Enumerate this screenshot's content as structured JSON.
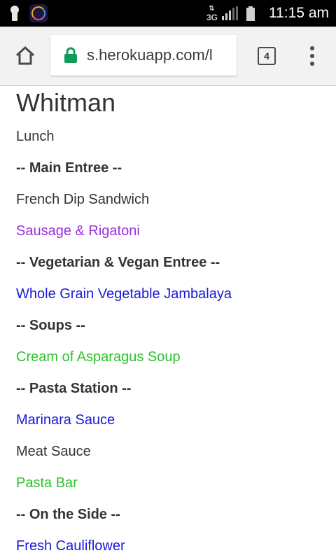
{
  "status_bar": {
    "network": "3G",
    "network_arrows": "⇅",
    "time": "11:15 am",
    "icons": [
      "keyhole-icon",
      "app-notification-icon",
      "signal-icon",
      "battery-icon"
    ]
  },
  "browser": {
    "url": "s.herokuapp.com/l",
    "tab_count": "4",
    "icons": [
      "home-icon",
      "lock-icon",
      "tab-switcher-icon",
      "overflow-menu-icon"
    ],
    "colors": {
      "lock": "#0f9d58",
      "toolbar": "#f2f2f2"
    }
  },
  "page": {
    "title": "Whitman",
    "items": [
      {
        "text": "Lunch",
        "kind": "meal",
        "color": "#333333"
      },
      {
        "text": "-- Main Entree --",
        "kind": "header",
        "color": "#333333"
      },
      {
        "text": "French Dip Sandwich",
        "kind": "item",
        "color": "#333333"
      },
      {
        "text": "Sausage & Rigatoni",
        "kind": "item",
        "color": "#9b30d9"
      },
      {
        "text": "-- Vegetarian & Vegan Entree --",
        "kind": "header",
        "color": "#333333"
      },
      {
        "text": "Whole Grain Vegetable Jambalaya",
        "kind": "item",
        "color": "#1a1ad6"
      },
      {
        "text": "-- Soups --",
        "kind": "header",
        "color": "#333333"
      },
      {
        "text": "Cream of Asparagus Soup",
        "kind": "item",
        "color": "#2ec22e"
      },
      {
        "text": "-- Pasta Station --",
        "kind": "header",
        "color": "#333333"
      },
      {
        "text": "Marinara Sauce",
        "kind": "item",
        "color": "#1a1ad6"
      },
      {
        "text": "Meat Sauce",
        "kind": "item",
        "color": "#333333"
      },
      {
        "text": "Pasta Bar",
        "kind": "item",
        "color": "#2ec22e"
      },
      {
        "text": "-- On the Side --",
        "kind": "header",
        "color": "#333333"
      },
      {
        "text": "Fresh Cauliflower",
        "kind": "item",
        "color": "#1a1ad6"
      }
    ]
  }
}
